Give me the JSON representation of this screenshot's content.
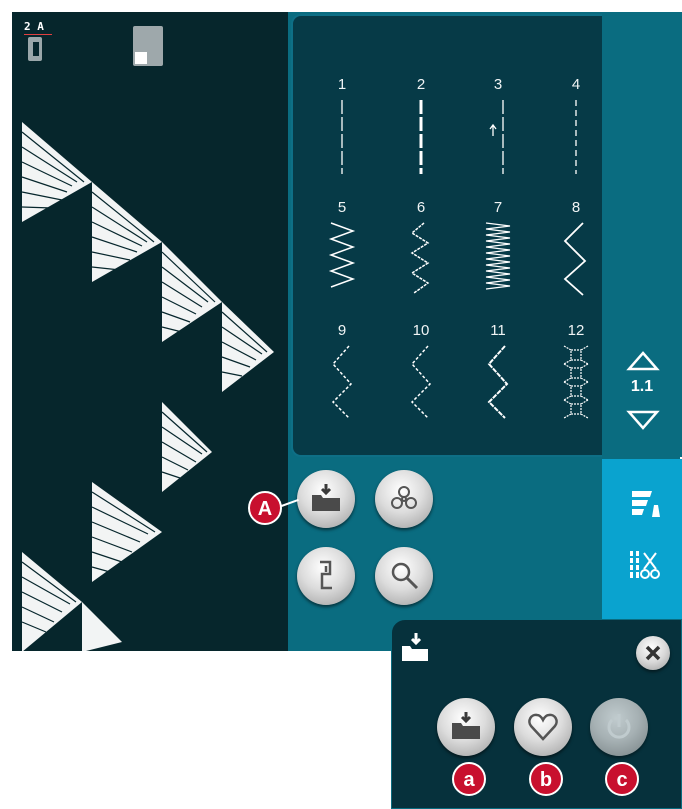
{
  "stitches": [
    {
      "number": "1",
      "pattern": "straight-thin"
    },
    {
      "number": "2",
      "pattern": "straight-bold"
    },
    {
      "number": "3",
      "pattern": "straight-reverse"
    },
    {
      "number": "4",
      "pattern": "straight-dashed"
    },
    {
      "number": "5",
      "pattern": "zigzag-wide"
    },
    {
      "number": "6",
      "pattern": "zigzag-stitched"
    },
    {
      "number": "7",
      "pattern": "satin-dense"
    },
    {
      "number": "8",
      "pattern": "zigzag-open"
    },
    {
      "number": "9",
      "pattern": "zigzag-dotted"
    },
    {
      "number": "10",
      "pattern": "zigzag-dotted"
    },
    {
      "number": "11",
      "pattern": "zigzag-three-step"
    },
    {
      "number": "12",
      "pattern": "honeycomb"
    }
  ],
  "page_indicator": "1.1",
  "presser_foot": {
    "label": "2 A"
  },
  "callouts": {
    "load_button": "A",
    "popup_load": "a",
    "popup_favorites": "b",
    "popup_power": "c"
  },
  "colors": {
    "stitch_area": "#06262c",
    "panel": "#0a6c80",
    "selection_panel": "#063a47",
    "tool_column": "#0aa3cf",
    "callout": "#c8102e"
  }
}
